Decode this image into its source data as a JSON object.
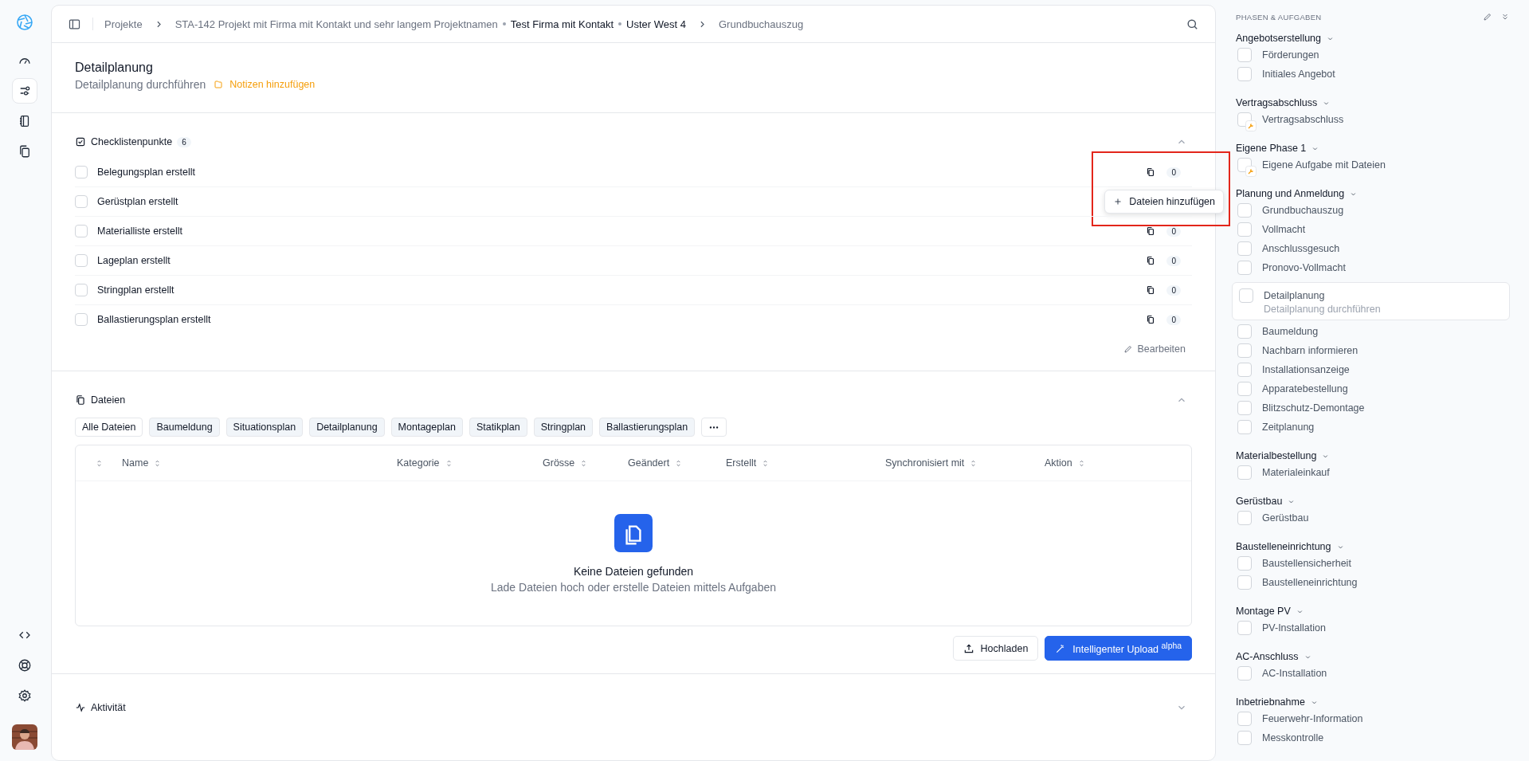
{
  "rail": {
    "top": [
      {
        "selected": false
      },
      {
        "selected": true
      },
      {
        "selected": false
      },
      {
        "selected": false
      }
    ],
    "bottom": [
      {
        "selected": false
      },
      {
        "selected": false
      },
      {
        "selected": false
      }
    ]
  },
  "breadcrumb": [
    {
      "items": [
        {
          "text": "Projekte",
          "strong": false
        }
      ]
    },
    {
      "items": [
        {
          "text": "STA-142 Projekt mit Firma mit Kontakt und sehr langem Projektnamen",
          "strong": false
        },
        {
          "text": "Test Firma mit Kontakt",
          "strong": true
        },
        {
          "text": "Uster West 4",
          "strong": true
        }
      ]
    },
    {
      "items": [
        {
          "text": "Grundbuchauszug",
          "strong": false
        }
      ]
    }
  ],
  "task": {
    "title": "Detailplanung",
    "subtitle": "Detailplanung durchführen",
    "notes_link": "Notizen hinzufügen"
  },
  "checklist": {
    "title": "Checklistenpunkte",
    "count": "6",
    "expanded": true,
    "edit_label": "Bearbeiten",
    "rows": [
      {
        "label": "Belegungsplan erstellt",
        "checked": false,
        "files": "0",
        "popover": {
          "label": "Dateien hinzufügen",
          "highlighted": true
        }
      },
      {
        "label": "Gerüstplan erstellt",
        "checked": false
      },
      {
        "label": "Materialliste erstellt",
        "checked": false,
        "files": "0"
      },
      {
        "label": "Lageplan erstellt",
        "checked": false,
        "files": "0"
      },
      {
        "label": "Stringplan erstellt",
        "checked": false,
        "files": "0"
      },
      {
        "label": "Ballastierungsplan erstellt",
        "checked": false,
        "files": "0"
      }
    ]
  },
  "files": {
    "title": "Dateien",
    "expanded": true,
    "filters": [
      {
        "label": "Alle Dateien",
        "selected": true
      },
      {
        "label": "Baumeldung",
        "selected": false
      },
      {
        "label": "Situationsplan",
        "selected": false
      },
      {
        "label": "Detailplanung",
        "selected": false
      },
      {
        "label": "Montageplan",
        "selected": false
      },
      {
        "label": "Statikplan",
        "selected": false
      },
      {
        "label": "Stringplan",
        "selected": false
      },
      {
        "label": "Ballastierungsplan",
        "selected": false
      }
    ],
    "columns": [
      "Name",
      "Kategorie",
      "Grösse",
      "Geändert",
      "Erstellt",
      "Synchronisiert mit",
      "Aktion"
    ],
    "empty_title": "Keine Dateien gefunden",
    "empty_text": "Lade Dateien hoch oder erstelle Dateien mittels Aufgaben",
    "upload_button": "Hochladen",
    "smart_upload_button": "Intelligenter Upload $^{alpha}$"
  },
  "activity": {
    "title": "Aktivität",
    "expanded": false
  },
  "phases": {
    "title": "PHASEN & AUFGABEN",
    "groups": [
      {
        "title": "Angebotserstellung",
        "expanded": true,
        "tasks": [
          {
            "label": "Förderungen",
            "checked": false,
            "selected": false,
            "kind": "task"
          },
          {
            "label": "Initiales Angebot",
            "checked": false,
            "selected": false,
            "kind": "task"
          }
        ]
      },
      {
        "title": "Vertragsabschluss",
        "expanded": true,
        "tasks": [
          {
            "label": "Vertragsabschluss",
            "checked": false,
            "selected": false,
            "kind": "automated"
          }
        ]
      },
      {
        "title": "Eigene Phase 1",
        "expanded": true,
        "tasks": [
          {
            "label": "Eigene Aufgabe mit Dateien",
            "checked": false,
            "selected": false,
            "kind": "automated"
          }
        ]
      },
      {
        "title": "Planung und Anmeldung",
        "expanded": true,
        "tasks": [
          {
            "label": "Grundbuchauszug",
            "checked": false,
            "selected": false,
            "kind": "task"
          },
          {
            "label": "Vollmacht",
            "checked": false,
            "selected": false,
            "kind": "task"
          },
          {
            "label": "Anschlussgesuch",
            "checked": false,
            "selected": false,
            "kind": "task"
          },
          {
            "label": "Pronovo-Vollmacht",
            "checked": false,
            "selected": false,
            "kind": "task"
          },
          {
            "label": "Detailplanung",
            "subtitle": "Detailplanung durchführen",
            "checked": false,
            "selected": true,
            "kind": "task"
          },
          {
            "label": "Baumeldung",
            "checked": false,
            "selected": false,
            "kind": "task"
          },
          {
            "label": "Nachbarn informieren",
            "checked": false,
            "selected": false,
            "kind": "task"
          },
          {
            "label": "Installationsanzeige",
            "checked": false,
            "selected": false,
            "kind": "task"
          },
          {
            "label": "Apparatebestellung",
            "checked": false,
            "selected": false,
            "kind": "task"
          },
          {
            "label": "Blitzschutz-Demontage",
            "checked": false,
            "selected": false,
            "kind": "task"
          },
          {
            "label": "Zeitplanung",
            "checked": false,
            "selected": false,
            "kind": "task"
          }
        ]
      },
      {
        "title": "Materialbestellung",
        "expanded": true,
        "tasks": [
          {
            "label": "Materialeinkauf",
            "checked": false,
            "selected": false,
            "kind": "task"
          }
        ]
      },
      {
        "title": "Gerüstbau",
        "expanded": true,
        "tasks": [
          {
            "label": "Gerüstbau",
            "checked": false,
            "selected": false,
            "kind": "task"
          }
        ]
      },
      {
        "title": "Baustelleneinrichtung",
        "expanded": true,
        "tasks": [
          {
            "label": "Baustellensicherheit",
            "checked": false,
            "selected": false,
            "kind": "task"
          },
          {
            "label": "Baustelleneinrichtung",
            "checked": false,
            "selected": false,
            "kind": "task"
          }
        ]
      },
      {
        "title": "Montage PV",
        "expanded": true,
        "tasks": [
          {
            "label": "PV-Installation",
            "checked": false,
            "selected": false,
            "kind": "task"
          }
        ]
      },
      {
        "title": "AC-Anschluss",
        "expanded": true,
        "tasks": [
          {
            "label": "AC-Installation",
            "checked": false,
            "selected": false,
            "kind": "task"
          }
        ]
      },
      {
        "title": "Inbetriebnahme",
        "expanded": true,
        "tasks": [
          {
            "label": "Feuerwehr-Information",
            "checked": false,
            "selected": false,
            "kind": "task"
          },
          {
            "label": "Messkontrolle",
            "checked": false,
            "selected": false,
            "kind": "task"
          }
        ]
      }
    ]
  }
}
